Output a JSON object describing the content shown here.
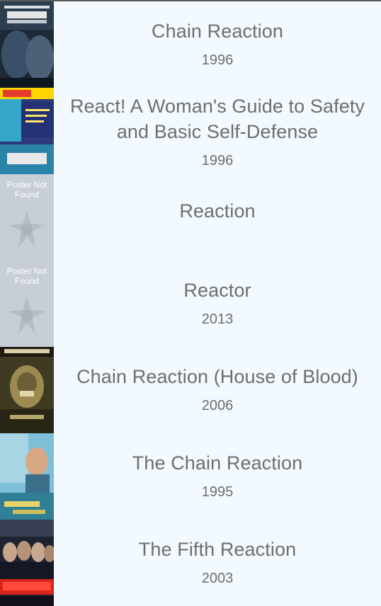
{
  "movies": [
    {
      "title": "Chain Reaction",
      "year": "1996",
      "poster": "chain-reaction-poster",
      "poster_text": "CHAIN REACTION"
    },
    {
      "title": "React! A Woman's Guide to Safety and Basic Self-Defense",
      "year": "1996",
      "poster": "react-poster",
      "poster_text": "REACT!"
    },
    {
      "title": "Reaction",
      "year": "",
      "poster": "poster-not-found",
      "poster_text": "Poster Not Found"
    },
    {
      "title": "Reactor",
      "year": "2013",
      "poster": "poster-not-found",
      "poster_text": "Poster Not Found"
    },
    {
      "title": "Chain Reaction (House of Blood)",
      "year": "2006",
      "poster": "house-of-blood-poster",
      "poster_text": "HOUSE OF BLOOD"
    },
    {
      "title": "The Chain Reaction",
      "year": "1995",
      "poster": "the-chain-reaction-poster",
      "poster_text": "Chain Reaction"
    },
    {
      "title": "The Fifth Reaction",
      "year": "2003",
      "poster": "fifth-reaction-poster",
      "poster_text": "fifth Reaction"
    }
  ],
  "colors": {
    "background": "#f2f9ff",
    "text": "#6e6e6e",
    "top_line": "#595959",
    "placeholder": "#c7ced6"
  }
}
